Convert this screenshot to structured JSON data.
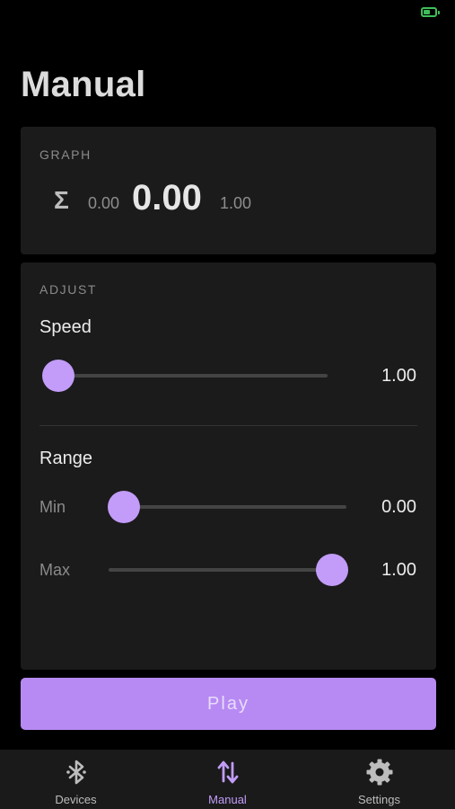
{
  "title": "Manual",
  "graph": {
    "section_label": "GRAPH",
    "icon": "sigma-icon",
    "min": "0.00",
    "value": "0.00",
    "max": "1.00"
  },
  "adjust": {
    "section_label": "ADJUST",
    "speed": {
      "label": "Speed",
      "value": "1.00",
      "position": 0.0
    },
    "range": {
      "label": "Range",
      "min": {
        "label": "Min",
        "value": "0.00",
        "position": 0.0
      },
      "max": {
        "label": "Max",
        "value": "1.00",
        "position": 1.0
      }
    }
  },
  "play_button": "Play",
  "tabs": [
    {
      "label": "Devices",
      "icon": "bluetooth-icon",
      "active": false
    },
    {
      "label": "Manual",
      "icon": "swap-vertical-icon",
      "active": true
    },
    {
      "label": "Settings",
      "icon": "gear-icon",
      "active": false
    }
  ],
  "colors": {
    "accent": "#c29cf8",
    "button": "#b78af3",
    "card": "#1b1b1c",
    "background": "#000000",
    "battery": "#3fbf5a"
  }
}
